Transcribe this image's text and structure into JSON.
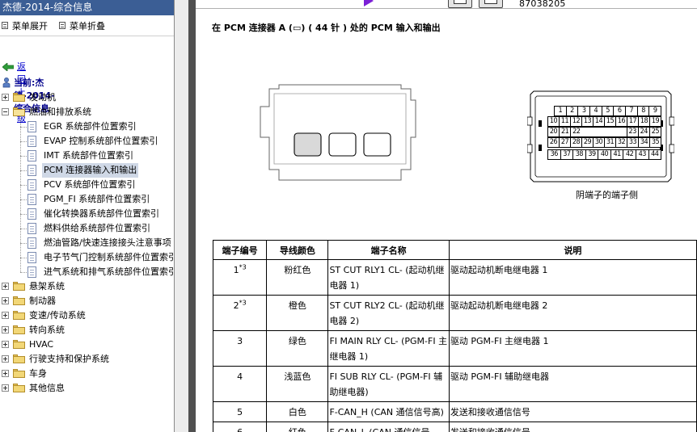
{
  "sidebar": {
    "title": "杰德-2014-综合信息",
    "toolbar": {
      "expand_all": "菜单展开",
      "collapse_all": "菜单折叠"
    },
    "back_link": "返回上一级",
    "current": "当前:杰德-2014-综合信息",
    "tree": [
      {
        "label": "发动机",
        "expanded": false
      },
      {
        "label": "燃油和排放系统",
        "expanded": true,
        "children": [
          "EGR 系统部件位置索引",
          "EVAP 控制系统部件位置索引",
          "IMT 系统部件位置索引",
          "PCM 连接器输入和输出",
          "PCV 系统部件位置索引",
          "PGM_FI 系统部件位置索引",
          "催化转换器系统部件位置索引",
          "燃料供给系统部件位置索引",
          "燃油管路/快速连接接头注意事项",
          "电子节气门控制系统部件位置索引",
          "进气系统和排气系统部件位置索引"
        ],
        "selected_child": 3
      },
      {
        "label": "悬架系统",
        "expanded": false
      },
      {
        "label": "制动器",
        "expanded": false
      },
      {
        "label": "变速/传动系统",
        "expanded": false
      },
      {
        "label": "转向系统",
        "expanded": false
      },
      {
        "label": "HVAC",
        "expanded": false
      },
      {
        "label": "行驶支持和保护系统",
        "expanded": false
      },
      {
        "label": "车身",
        "expanded": false
      },
      {
        "label": "其他信息",
        "expanded": false
      }
    ]
  },
  "topbar": {
    "doc_number": "87038205"
  },
  "content": {
    "title": "在 PCM 连接器 A (▭) ( 44 针 ) 处的 PCM 输入和输出",
    "connector_caption": "阴端子的端子侧",
    "connector_pins": [
      [
        "1",
        "2",
        "3",
        "4",
        "5",
        "6",
        "7",
        "8",
        "9"
      ],
      [
        "10",
        "11",
        "12",
        "13",
        "14",
        "15",
        "16",
        "17",
        "18",
        "19"
      ],
      [
        "20",
        "21",
        "22",
        "",
        "",
        "",
        "",
        "23",
        "24",
        "25"
      ],
      [
        "26",
        "27",
        "28",
        "29",
        "30",
        "31",
        "32",
        "33",
        "34",
        "35"
      ],
      [
        "36",
        "37",
        "38",
        "39",
        "40",
        "41",
        "42",
        "43",
        "44"
      ]
    ],
    "table": {
      "headers": [
        "端子编号",
        "导线颜色",
        "端子名称",
        "说明"
      ],
      "rows": [
        {
          "num": "1",
          "sup": "*3",
          "color": "粉红色",
          "name": "ST CUT RLY1 CL- (起动机继电器 1)",
          "desc": "驱动起动机断电继电器 1"
        },
        {
          "num": "2",
          "sup": "*3",
          "color": "橙色",
          "name": "ST CUT RLY2 CL- (起动机继电器 2)",
          "desc": "驱动起动机断电继电器 2"
        },
        {
          "num": "3",
          "sup": "",
          "color": "绿色",
          "name": "FI MAIN RLY CL- (PGM-FI 主继电器 1)",
          "desc": "驱动 PGM-FI 主继电器 1"
        },
        {
          "num": "4",
          "sup": "",
          "color": "浅蓝色",
          "name": "FI SUB RLY CL- (PGM-FI 辅助继电器)",
          "desc": "驱动 PGM-FI 辅助继电器"
        },
        {
          "num": "5",
          "sup": "",
          "color": "白色",
          "name": "F-CAN_H (CAN 通信信号高)",
          "desc": "发送和接收通信信号"
        },
        {
          "num": "6",
          "sup": "",
          "color": "红色",
          "name": "F-CAN_L (CAN 通信信号",
          "desc": "发送和接收通信信号"
        }
      ]
    }
  }
}
